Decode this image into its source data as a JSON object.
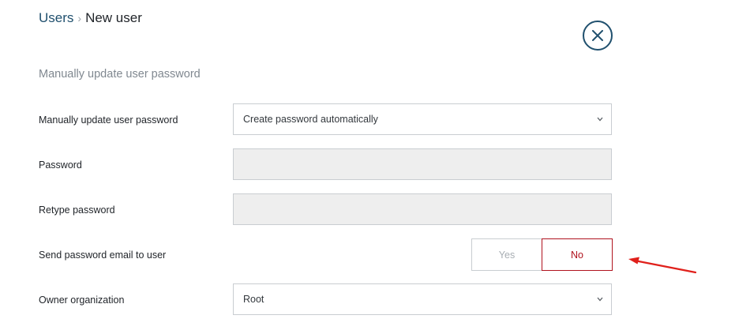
{
  "breadcrumb": {
    "parent": "Users",
    "separator": "›",
    "current": "New user"
  },
  "section_title": "Manually update user password",
  "form": {
    "password_mode": {
      "label": "Manually update user password",
      "value": "Create password automatically"
    },
    "password": {
      "label": "Password",
      "value": ""
    },
    "retype_password": {
      "label": "Retype password",
      "value": ""
    },
    "send_email": {
      "label": "Send password email to user",
      "yes": "Yes",
      "no": "No",
      "selected": "No"
    },
    "owner_org": {
      "label": "Owner organization",
      "value": "Root"
    }
  },
  "colors": {
    "primary": "#20506e",
    "selected_red": "#b0131e",
    "annotation_red": "#e0201b",
    "disabled_bg": "#eeeeee",
    "border": "#c9cdd1"
  },
  "icons": {
    "close": "close-icon",
    "select": "chevron-down-icon",
    "annotation": "red-arrow-annotation"
  }
}
